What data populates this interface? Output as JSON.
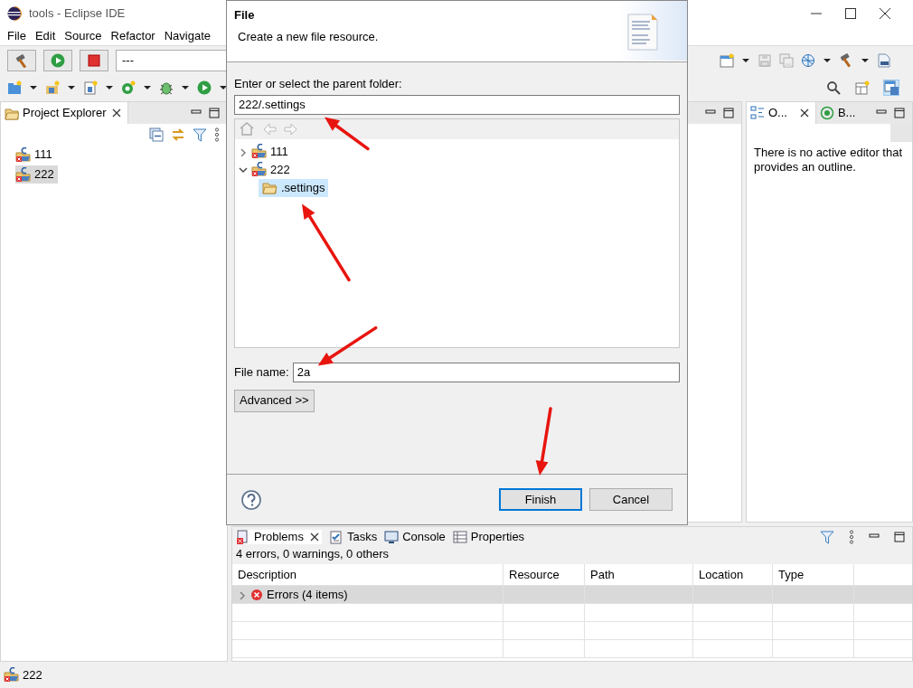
{
  "window": {
    "title": "tools - Eclipse IDE"
  },
  "menu": [
    "File",
    "Edit",
    "Source",
    "Refactor",
    "Navigate"
  ],
  "toolbar": {
    "launch_config": "---"
  },
  "project_explorer": {
    "title": "Project Explorer",
    "items": [
      {
        "label": "111",
        "selected": false
      },
      {
        "label": "222",
        "selected": true
      }
    ]
  },
  "outline": {
    "tabs": [
      {
        "label": "O...",
        "selected": true
      },
      {
        "label": "B...",
        "selected": false
      }
    ],
    "message": "There is no active editor that provides an outline."
  },
  "problems": {
    "tabs": [
      {
        "label": "Problems",
        "selected": true
      },
      {
        "label": "Tasks",
        "selected": false
      },
      {
        "label": "Console",
        "selected": false
      },
      {
        "label": "Properties",
        "selected": false
      }
    ],
    "summary": "4 errors, 0 warnings, 0 others",
    "columns": [
      "Description",
      "Resource",
      "Path",
      "Location",
      "Type"
    ],
    "rows": [
      {
        "label": "Errors (4 items)",
        "expanded": false,
        "selected": true
      }
    ]
  },
  "status_bar": {
    "selection": "222"
  },
  "dialog": {
    "title": "File",
    "subtitle": "Create a new file resource.",
    "folder_label": "Enter or select the parent folder:",
    "folder_value": "222/.settings",
    "folder_annotated": true,
    "tree": [
      {
        "label": "111",
        "expanded": false,
        "selected": false
      },
      {
        "label": "222",
        "expanded": true,
        "selected": false,
        "children": [
          {
            "label": ".settings",
            "selected": true,
            "annotated": true
          }
        ]
      }
    ],
    "file_name_label": "File name:",
    "file_name_value": "2a",
    "file_name_annotated": true,
    "advanced_button": "Advanced >>",
    "footer_buttons": [
      {
        "label": "Finish",
        "default": true,
        "annotated": true
      },
      {
        "label": "Cancel",
        "default": false
      }
    ]
  }
}
